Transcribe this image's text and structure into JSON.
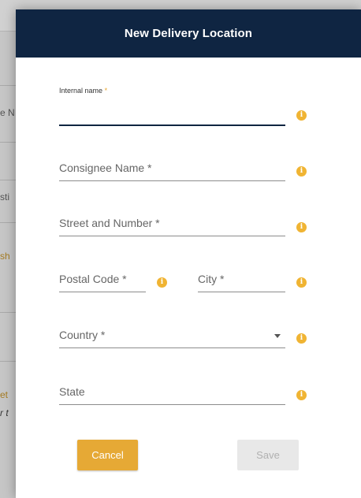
{
  "background": {
    "fragments": [
      {
        "text": "e N",
        "style": "normal"
      },
      {
        "text": "sti",
        "style": "normal"
      },
      {
        "text": "sh",
        "style": "gold"
      },
      {
        "text": "et",
        "style": "gold"
      },
      {
        "text": "r t",
        "style": "italic"
      }
    ]
  },
  "modal": {
    "title": "New Delivery Location",
    "fields": {
      "internal_name": {
        "label": "Internal name",
        "required_mark": "*",
        "value": ""
      },
      "consignee_name": {
        "placeholder": "Consignee Name *"
      },
      "street_number": {
        "placeholder": "Street and Number *"
      },
      "postal_code": {
        "placeholder": "Postal Code *"
      },
      "city": {
        "placeholder": "City *"
      },
      "country": {
        "placeholder": "Country *"
      },
      "state": {
        "placeholder": "State"
      }
    },
    "info_icon_glyph": "i",
    "buttons": {
      "cancel": "Cancel",
      "save": "Save"
    }
  },
  "colors": {
    "header_bg": "#0f2542",
    "accent": "#e6a935",
    "info_icon": "#f0b433"
  }
}
